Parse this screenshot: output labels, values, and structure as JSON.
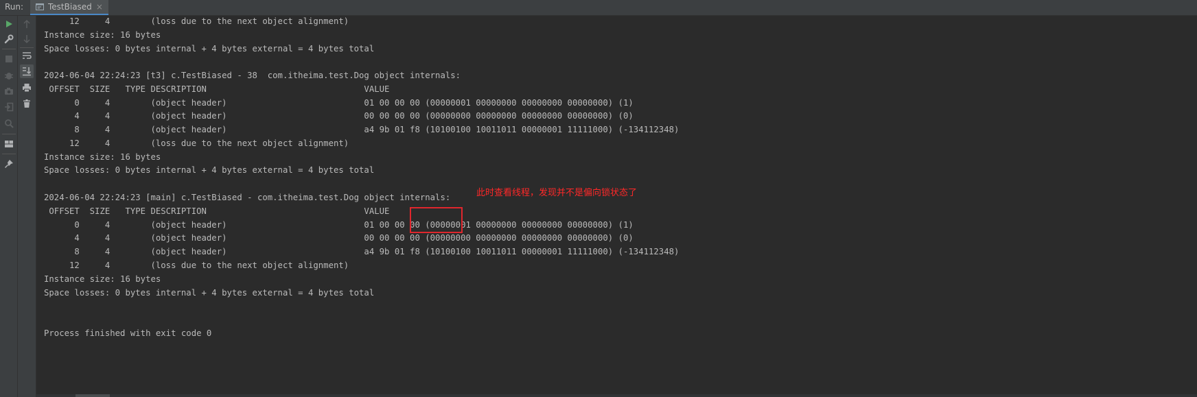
{
  "topbar": {
    "run_label": "Run:",
    "tab_label": "TestBiased",
    "tab_close": "×"
  },
  "toolbar_left": [
    "rerun-icon",
    "wrench-icon",
    "stop-icon",
    "debug-icon",
    "camera-icon",
    "login-icon",
    "search-icon",
    "layout-icon",
    "pin-icon"
  ],
  "toolbar_right": [
    "up-arrow-icon",
    "down-arrow-icon",
    "soft-wrap-icon",
    "scroll-to-end-icon",
    "print-icon",
    "trash-icon"
  ],
  "colors": {
    "background": "#2b2b2b",
    "text": "#bbbbbb",
    "annotation": "#ff2828",
    "run_green": "#59a869"
  },
  "console": {
    "lines": [
      "     12     4        (loss due to the next object alignment)",
      "Instance size: 16 bytes",
      "Space losses: 0 bytes internal + 4 bytes external = 4 bytes total",
      "",
      "2024-06-04 22:24:23 [t3] c.TestBiased - 38  com.itheima.test.Dog object internals:",
      " OFFSET  SIZE   TYPE DESCRIPTION                               VALUE",
      "      0     4        (object header)                           01 00 00 00 (00000001 00000000 00000000 00000000) (1)",
      "      4     4        (object header)                           00 00 00 00 (00000000 00000000 00000000 00000000) (0)",
      "      8     4        (object header)                           a4 9b 01 f8 (10100100 10011011 00000001 11111000) (-134112348)",
      "     12     4        (loss due to the next object alignment)",
      "Instance size: 16 bytes",
      "Space losses: 0 bytes internal + 4 bytes external = 4 bytes total",
      "",
      "2024-06-04 22:24:23 [main] c.TestBiased - com.itheima.test.Dog object internals:",
      " OFFSET  SIZE   TYPE DESCRIPTION                               VALUE",
      "      0     4        (object header)                           01 00 00 00 (00000001 00000000 00000000 00000000) (1)",
      "      4     4        (object header)                           00 00 00 00 (00000000 00000000 00000000 00000000) (0)",
      "      8     4        (object header)                           a4 9b 01 f8 (10100100 10011011 00000001 11111000) (-134112348)",
      "     12     4        (loss due to the next object alignment)",
      "Instance size: 16 bytes",
      "Space losses: 0 bytes internal + 4 bytes external = 4 bytes total",
      "",
      "",
      "Process finished with exit code 0"
    ]
  },
  "annotation": {
    "text": "此时查看线程，发现并不是偏向锁状态了"
  }
}
